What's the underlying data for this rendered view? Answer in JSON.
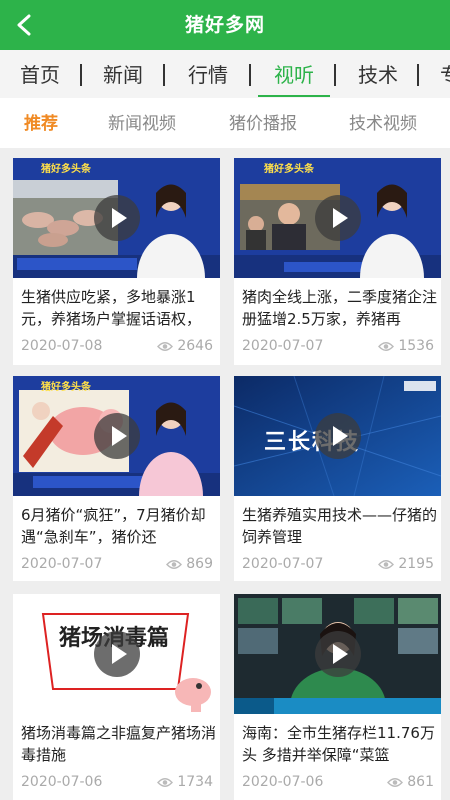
{
  "header": {
    "title": "猪好多网",
    "back_icon": "chevron-left-icon"
  },
  "nav": {
    "tabs": [
      {
        "label": "首页"
      },
      {
        "label": "新闻"
      },
      {
        "label": "行情"
      },
      {
        "label": "视听",
        "active": true
      },
      {
        "label": "技术"
      },
      {
        "label": "专"
      }
    ]
  },
  "subtabs": [
    {
      "label": "推荐",
      "active": true
    },
    {
      "label": "新闻视频"
    },
    {
      "label": "猪价播报"
    },
    {
      "label": "技术视频"
    }
  ],
  "cards": [
    {
      "title": "生猪供应吃紧，多地暴涨1元，养猪场户掌握话语权，",
      "date": "2020-07-08",
      "views": "2646"
    },
    {
      "title": "猪肉全线上涨，二季度猪企注册猛增2.5万家，养猪再",
      "date": "2020-07-07",
      "views": "1536"
    },
    {
      "title": "6月猪价“疯狂”，7月猪价却遇“急刹车”，猪价还",
      "date": "2020-07-07",
      "views": "869"
    },
    {
      "title": "生猪养殖实用技术——仔猪的饲养管理",
      "date": "2020-07-07",
      "views": "2195"
    },
    {
      "title": "猪场消毒篇之非瘟复产猪场消毒措施",
      "date": "2020-07-06",
      "views": "1734"
    },
    {
      "title": "海南：全市生猪存栏11.76万头 多措并举保障“菜篮",
      "date": "2020-07-06",
      "views": "861"
    }
  ],
  "thumb_text": {
    "brand": "猪好多头条",
    "card4_brand": "三长科技",
    "card5_title": "猪场消毒篇"
  },
  "colors": {
    "primary": "#2db34a",
    "accent": "#f08a24",
    "news_blue": "#1a3fa8"
  }
}
